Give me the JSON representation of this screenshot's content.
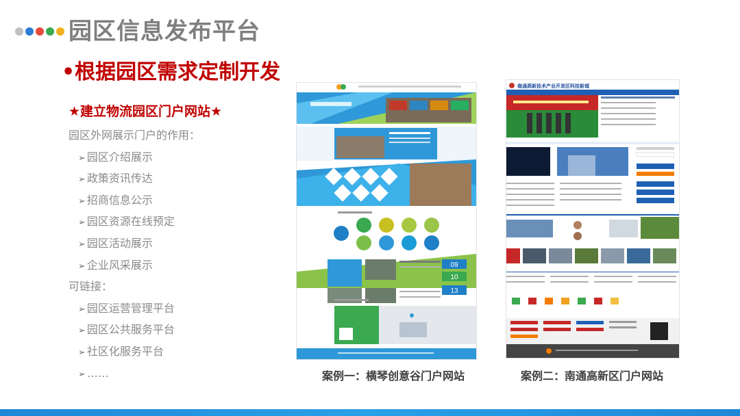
{
  "colors": {
    "dots": [
      "#c0c0c0",
      "#2b7dd4",
      "#e84a3c",
      "#3aa94f",
      "#f2b020"
    ],
    "title_gray": "#7f7f7f",
    "accent_red": "#c00000",
    "bottom_bar": "#1e88d6"
  },
  "slide": {
    "title": "园区信息发布平台",
    "subtitle": "•根据园区需求定制开发",
    "heading": "★建立物流园区门户网站★",
    "intro": "园区外网展示门户的作用：",
    "functions": [
      "园区介绍展示",
      "政策资讯传达",
      "招商信息公示",
      "园区资源在线预定",
      "园区活动展示",
      "企业风采展示"
    ],
    "link_intro": "可链接：",
    "links": [
      "园区运营管理平台",
      "园区公共服务平台",
      "社区化服务平台",
      "……"
    ]
  },
  "cases": [
    {
      "caption": "案例一：横琴创意谷门户网站",
      "stats": [
        "09",
        "10",
        "13"
      ]
    },
    {
      "caption": "案例二：南通高新区门户网站",
      "site_title": "南通高新技术产业开发区科技新城"
    }
  ]
}
